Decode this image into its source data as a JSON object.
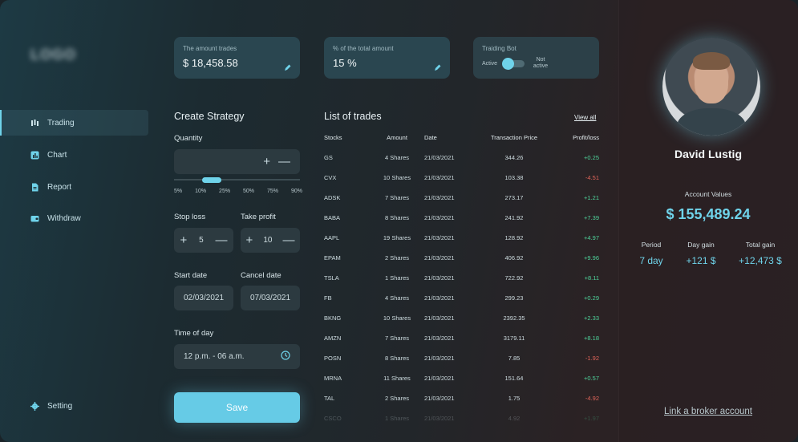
{
  "sidebar": {
    "logo": "LOGO",
    "items": [
      {
        "label": "Trading",
        "icon": "trading-icon",
        "active": true
      },
      {
        "label": "Chart",
        "icon": "chart-icon"
      },
      {
        "label": "Report",
        "icon": "report-icon"
      },
      {
        "label": "Withdraw",
        "icon": "withdraw-icon"
      }
    ],
    "setting": {
      "label": "Setting",
      "icon": "gear-icon"
    }
  },
  "cards": {
    "amount": {
      "label": "The amount trades",
      "value": "$ 18,458.58"
    },
    "percent": {
      "label": "% of the total amount",
      "value": "15 %"
    },
    "bot": {
      "label": "Traiding Bot",
      "active_label": "Active",
      "not_active_label": "Not active"
    }
  },
  "strategy": {
    "title": "Create Strategy",
    "quantity_label": "Quantity",
    "quantity_level": 0.1,
    "ticks": [
      "5%",
      "10%",
      "25%",
      "50%",
      "75%",
      "90%"
    ],
    "stop_loss": {
      "label": "Stop loss",
      "value": "5"
    },
    "take_profit": {
      "label": "Take profit",
      "value": "10"
    },
    "start_date": {
      "label": "Start date",
      "value": "02/03/2021"
    },
    "cancel_date": {
      "label": "Cancel date",
      "value": "07/03/2021"
    },
    "time_of_day": {
      "label": "Time of day",
      "value": "12 p.m. - 06 a.m."
    },
    "save_label": "Save"
  },
  "trades": {
    "title": "List of trades",
    "view_all": "View all",
    "columns": [
      "Stocks",
      "Amount",
      "Date",
      "Transaction Price",
      "Profit/loss"
    ],
    "rows": [
      [
        "GS",
        "4 Shares",
        "21/03/2021",
        "344.26",
        "+0.25"
      ],
      [
        "CVX",
        "10 Shares",
        "21/03/2021",
        "103.38",
        "-4.51"
      ],
      [
        "ADSK",
        "7 Shares",
        "21/03/2021",
        "273.17",
        "+1.21"
      ],
      [
        "BABA",
        "8 Shares",
        "21/03/2021",
        "241.92",
        "+7.39"
      ],
      [
        "AAPL",
        "19 Shares",
        "21/03/2021",
        "128.92",
        "+4.97"
      ],
      [
        "EPAM",
        "2 Shares",
        "21/03/2021",
        "406.92",
        "+9.96"
      ],
      [
        "TSLA",
        "1 Shares",
        "21/03/2021",
        "722.92",
        "+8.11"
      ],
      [
        "FB",
        "4 Shares",
        "21/03/2021",
        "299.23",
        "+0.29"
      ],
      [
        "BKNG",
        "10 Shares",
        "21/03/2021",
        "2392.35",
        "+2.33"
      ],
      [
        "AMZN",
        "7 Shares",
        "21/03/2021",
        "3179.11",
        "+8.18"
      ],
      [
        "POSN",
        "8 Shares",
        "21/03/2021",
        "7.85",
        "-1.92"
      ],
      [
        "MRNA",
        "11 Shares",
        "21/03/2021",
        "151.64",
        "+0.57"
      ],
      [
        "TAL",
        "2 Shares",
        "21/03/2021",
        "1.75",
        "-4.92"
      ],
      [
        "CSCO",
        "1 Shares",
        "21/03/2021",
        "4.92",
        "+1.97"
      ]
    ]
  },
  "profile": {
    "name": "David Lustig",
    "account_label": "Account Values",
    "account_value": "$ 155,489.24",
    "stats": [
      {
        "label": "Period",
        "value": "7 day"
      },
      {
        "label": "Day gain",
        "value": "+121 $"
      },
      {
        "label": "Total gain",
        "value": "+12,473 $"
      }
    ],
    "link": "Link a broker account"
  },
  "colors": {
    "accent": "#6fd3ea",
    "positive": "#4ed19a",
    "negative": "#e0655a"
  }
}
